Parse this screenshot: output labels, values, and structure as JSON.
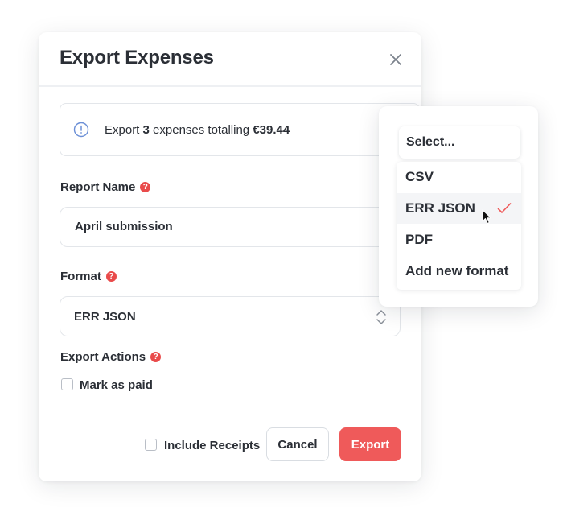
{
  "dialog": {
    "title": "Export Expenses",
    "info": {
      "prefix": "Export",
      "count": "3",
      "middle": "expenses totalling",
      "amount": "€39.44"
    },
    "report_name": {
      "label": "Report Name",
      "value": "April submission"
    },
    "format": {
      "label": "Format",
      "value": "ERR JSON"
    },
    "export_actions": {
      "label": "Export Actions",
      "mark_as_paid": "Mark as paid"
    },
    "include_receipts": "Include Receipts",
    "buttons": {
      "cancel": "Cancel",
      "export": "Export"
    }
  },
  "dropdown": {
    "placeholder": "Select...",
    "options": [
      {
        "label": "CSV",
        "selected": false
      },
      {
        "label": "ERR JSON",
        "selected": true
      },
      {
        "label": "PDF",
        "selected": false
      },
      {
        "label": "Add new format",
        "selected": false
      }
    ]
  },
  "icons": {
    "info": "info-circle-icon",
    "close": "close-icon",
    "help": "question-icon",
    "stepper": "chevron-up-down-icon",
    "check": "checkmark-icon",
    "cursor": "mouse-pointer-icon"
  },
  "colors": {
    "accent": "#ef5a5a",
    "help": "#e94b4b",
    "info_icon": "#6b8fd6",
    "text": "#2b2f36"
  }
}
